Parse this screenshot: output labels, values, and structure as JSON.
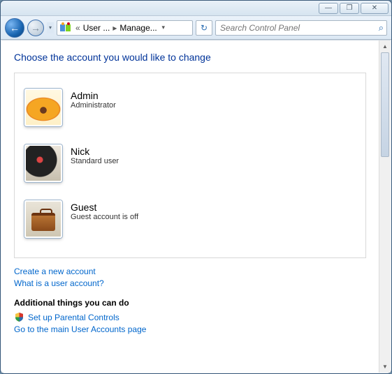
{
  "titlebar": {
    "min": "—",
    "max": "❐",
    "close": "✕"
  },
  "nav": {
    "back_glyph": "←",
    "fwd_glyph": "→",
    "hist_glyph": "▾",
    "refresh_glyph": "↻"
  },
  "breadcrumb": {
    "chev_left": "«",
    "seg1": "User ...",
    "sep": "▸",
    "seg2": "Manage...",
    "dd": "▾"
  },
  "search": {
    "placeholder": "Search Control Panel",
    "icon": "⌕"
  },
  "page": {
    "title": "Choose the account you would like to change"
  },
  "accounts": [
    {
      "name": "Admin",
      "role": "Administrator",
      "pic": "flower"
    },
    {
      "name": "Nick",
      "role": "Standard user",
      "pic": "record"
    },
    {
      "name": "Guest",
      "role": "Guest account is off",
      "pic": "suitcase"
    }
  ],
  "links": {
    "create": "Create a new account",
    "what_is": "What is a user account?"
  },
  "additional": {
    "heading": "Additional things you can do",
    "parental": "Set up Parental Controls",
    "main_page": "Go to the main User Accounts page"
  },
  "scroll": {
    "up": "▲",
    "down": "▼"
  }
}
